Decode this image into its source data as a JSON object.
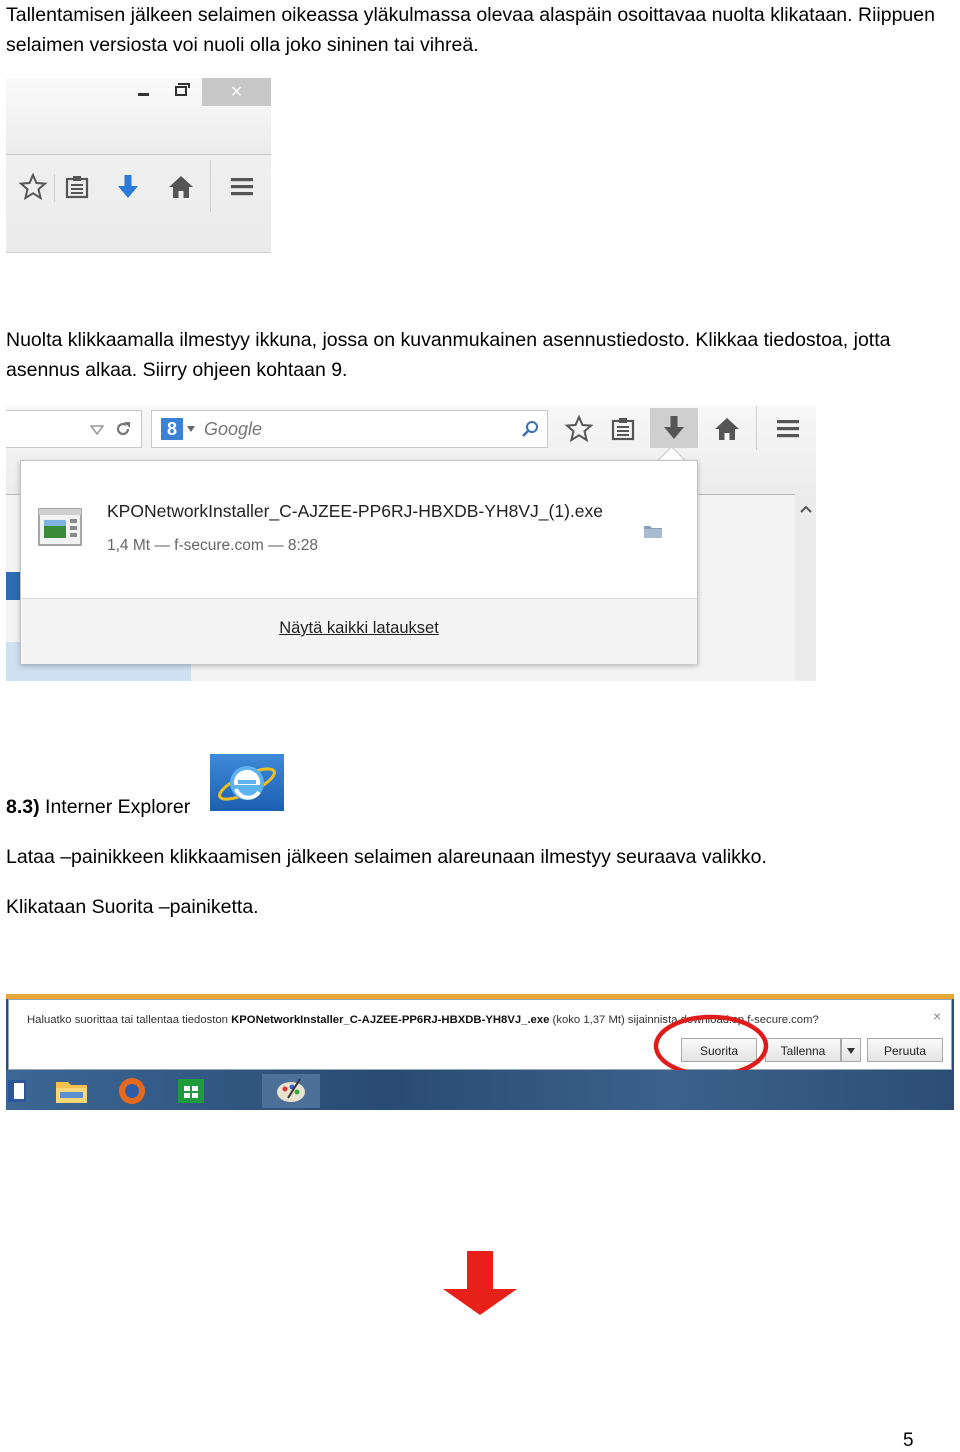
{
  "paragraph1": {
    "line1": "Tallentamisen jälkeen selaimen oikeassa yläkulmassa olevaa alaspäin osoittavaa nuolta klikataan. Riippuen",
    "line2": "selaimen versiosta voi nuoli olla joko sininen tai vihreä."
  },
  "firefox_toolbar": {
    "close_glyph": "×",
    "icons": [
      "star-icon",
      "bookmarks-list-icon",
      "download-arrow-icon",
      "home-icon",
      "menu-icon"
    ],
    "download_arrow_color": "#2a7bd8"
  },
  "paragraph2": {
    "line1": "Nuolta klikkaamalla ilmestyy ikkuna, jossa on kuvanmukainen asennustiedosto. Klikkaa tiedostoa, jotta",
    "line2": "asennus alkaa. Siirry ohjeen kohtaan 9."
  },
  "downloads_panel": {
    "search_engine_glyph": "8",
    "search_placeholder": "Google",
    "file_name": "KPONetworkInstaller_C-AJZEE-PP6RJ-HBXDB-YH8VJ_(1).exe",
    "file_meta": "1,4 Mt — f-secure.com — 8:28",
    "show_all": "Näytä kaikki lataukset"
  },
  "section_heading": {
    "number": "8.3)",
    "title": " Interner Explorer"
  },
  "paragraph3": "Lataa –painikkeen klikkaamisen jälkeen selaimen alareunaan ilmestyy seuraava valikko.",
  "paragraph4": "Klikataan Suorita –painiketta.",
  "ie_notification": {
    "prefix": "Haluatko suorittaa tai tallentaa tiedoston ",
    "file_name": "KPONetworkInstaller_C-AJZEE-PP6RJ-HBXDB-YH8VJ_.exe",
    "suffix": " (koko 1,37 Mt) sijainnista download.sp.f-secure.com?",
    "close_glyph": "×",
    "run_button": "Suorita",
    "save_button": "Tallenna",
    "cancel_button": "Peruuta",
    "highlight_color": "#e01b1b"
  },
  "arrow_color": "#e8201a",
  "page_number": "5"
}
